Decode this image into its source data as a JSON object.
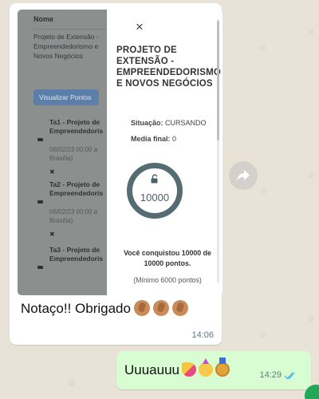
{
  "incoming": {
    "screenshot": {
      "left_panel": {
        "column_label": "Nome",
        "course_name": "Projeto de Extensão - Empreendedorismo e Novos Negócios",
        "button_label": "Visualizar Pontos",
        "tasks": [
          {
            "title1": "Ta1 - Projeto de",
            "title2": "Empreendedoris",
            "date1": "06/02/23 00:00 a",
            "date2": "Brasília)"
          },
          {
            "title1": "Ta2 - Projeto de",
            "title2": "Empreendedoris",
            "date1": "06/02/23 00:00 a",
            "date2": "Brasília)"
          },
          {
            "title1": "Ta3 - Projeto de",
            "title2": "Empreendedoris",
            "date1": "",
            "date2": ""
          }
        ]
      },
      "modal": {
        "close_glyph": "×",
        "title": "PROJETO DE EXTENSÃO - EMPREENDEDORISMO E NOVOS NEGÓCIOS",
        "status_label": "Situação:",
        "status_value": "CURSANDO",
        "grade_label": "Media final:",
        "grade_value": "0",
        "points": "10000",
        "achieved_text": "Você conquistou 10000 de 10000 pontos.",
        "minimum_text": "(Mínimo 6000 pontos)",
        "ring_color": "#566c73"
      }
    },
    "caption": "Notaço!! Obrigado",
    "emojis": [
      "clapping-hands",
      "clapping-hands",
      "clapping-hands"
    ],
    "time": "14:06"
  },
  "outgoing": {
    "text": "Uuuauuu",
    "emojis": [
      "party-popper",
      "partying-face",
      "medal"
    ],
    "time": "14:29",
    "status": "read"
  },
  "colors": {
    "chat_background": "#e9e2d6",
    "incoming_bubble": "#ffffff",
    "outgoing_bubble": "#d9fdd3",
    "read_ticks": "#53bdeb"
  }
}
